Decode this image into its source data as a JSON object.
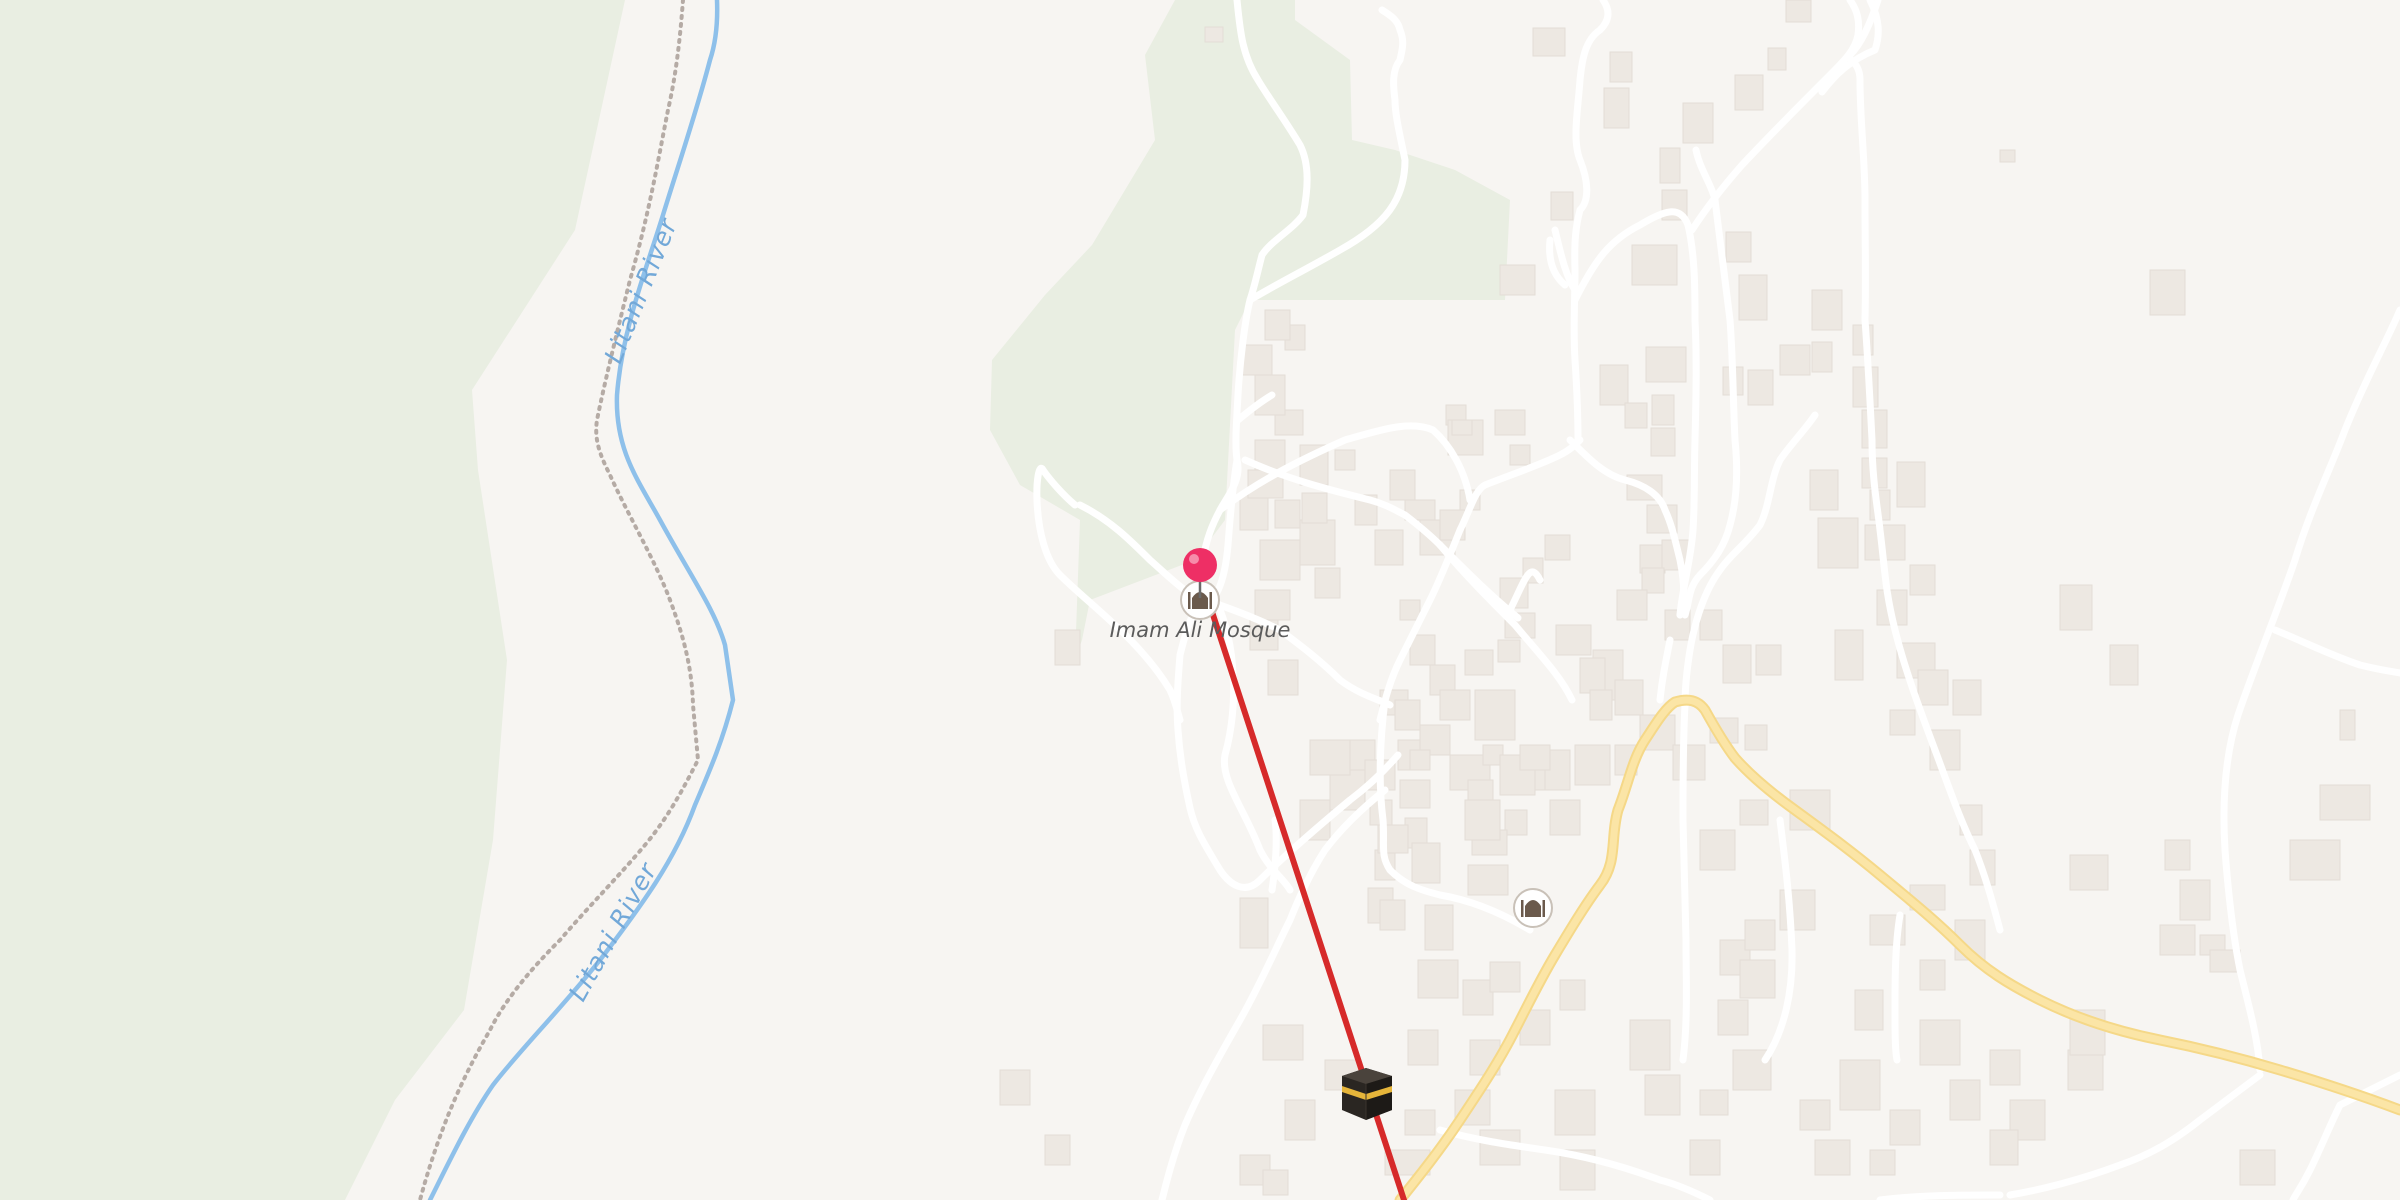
{
  "map": {
    "labels": {
      "river": "Litani River",
      "mosque": "Imam Ali Mosque"
    },
    "icons": {
      "pin": "location-pin-icon",
      "mosque": "mosque-icon",
      "qibla": "kaaba-icon"
    },
    "colors": {
      "background": "#f7f5f2",
      "forest": "#e9eee2",
      "river": "#8ec0ea",
      "road": "#ffffff",
      "main_road": "#fbe3a0",
      "building": "#ede8e2",
      "qibla_line": "#d62a2a",
      "pin": "#ee2f65"
    }
  }
}
